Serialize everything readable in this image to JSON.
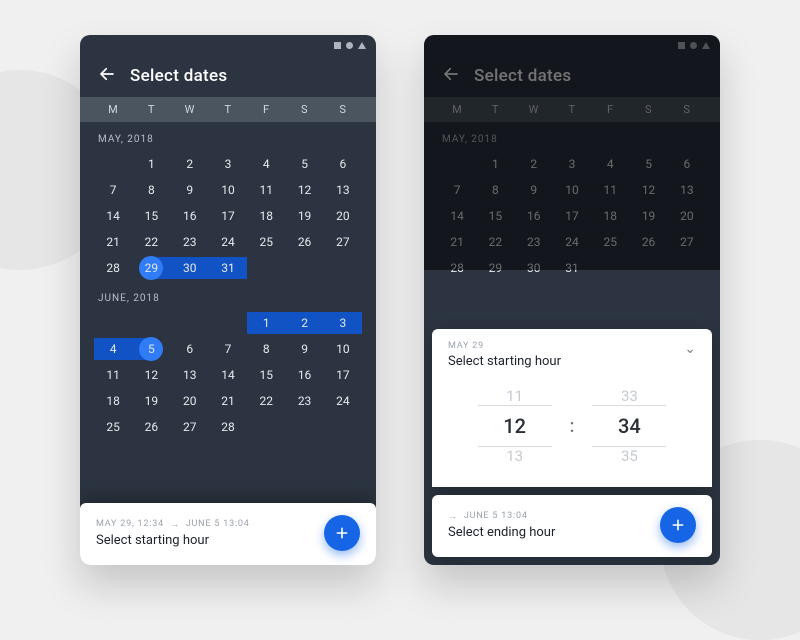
{
  "weekdays": [
    "M",
    "T",
    "W",
    "T",
    "F",
    "S",
    "S"
  ],
  "status_icons": [
    "square",
    "circle",
    "triangle"
  ],
  "left": {
    "title": "Select dates",
    "months": [
      {
        "label": "MAY, 2018",
        "lead_blanks": 1,
        "days": 31,
        "selection": {
          "start": 29,
          "end": 31,
          "circle_on": 29
        }
      },
      {
        "label": "JUNE, 2018",
        "lead_blanks": 4,
        "days": 30,
        "render_days": 28,
        "selection": {
          "start": 1,
          "end": 5,
          "circle_on": 5
        }
      }
    ],
    "footer": {
      "from": "MAY 29, 12:34",
      "to": "JUNE 5 13:04",
      "title": "Select starting hour"
    }
  },
  "right": {
    "title": "Select dates",
    "bg_month": {
      "label": "MAY, 2018",
      "lead_blanks": 1,
      "days": 31
    },
    "sheet_top": {
      "meta": "MAY 29",
      "title": "Select starting hour",
      "hour_prev": "11",
      "hour": "12",
      "hour_next": "13",
      "min_prev": "33",
      "min": "34",
      "min_next": "35"
    },
    "sheet_bottom": {
      "meta": "JUNE 5 13:04",
      "title": "Select ending hour"
    }
  }
}
